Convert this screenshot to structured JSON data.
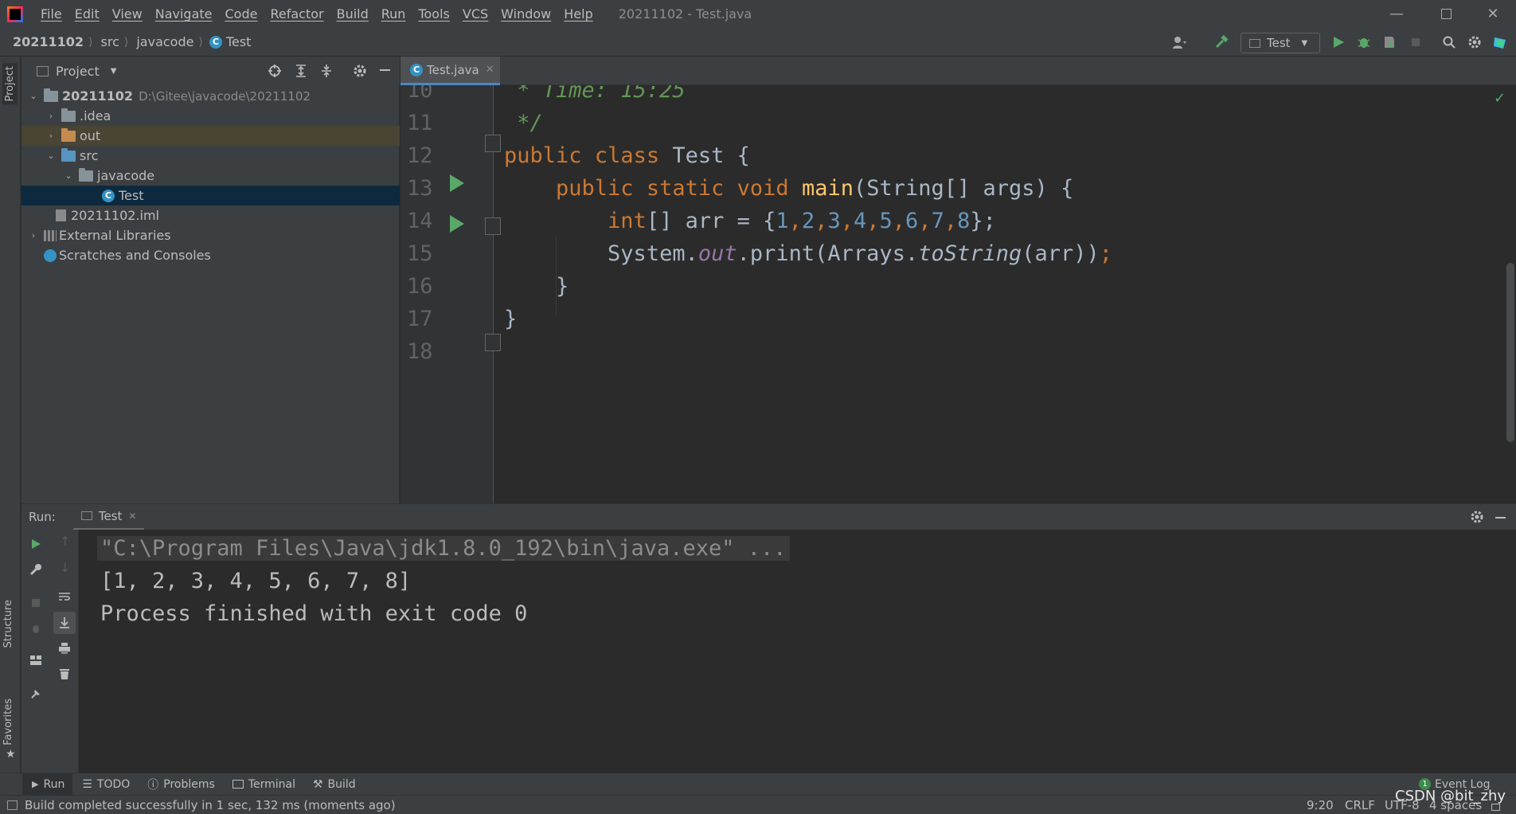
{
  "window": {
    "title": "20211102 - Test.java",
    "menu": [
      "File",
      "Edit",
      "View",
      "Navigate",
      "Code",
      "Refactor",
      "Build",
      "Run",
      "Tools",
      "VCS",
      "Window",
      "Help"
    ]
  },
  "breadcrumb": [
    "20211102",
    "src",
    "javacode",
    "Test"
  ],
  "toolbar": {
    "run_config": "Test"
  },
  "left_strip": {
    "project_tab": "Project",
    "structure_tab": "Structure",
    "favorites_tab": "Favorites"
  },
  "project": {
    "header": "Project",
    "tree": [
      {
        "label": "20211102",
        "path": "D:\\Gitee\\javacode\\20211102"
      },
      {
        "label": ".idea"
      },
      {
        "label": "out"
      },
      {
        "label": "src"
      },
      {
        "label": "javacode"
      },
      {
        "label": "Test"
      },
      {
        "label": "20211102.iml"
      },
      {
        "label": "External Libraries"
      },
      {
        "label": "Scratches and Consoles"
      }
    ]
  },
  "editor": {
    "tab": "Test.java",
    "line_numbers": [
      "10",
      "11",
      "12",
      "13",
      "14",
      "15",
      "16",
      "17",
      "18"
    ],
    "code": {
      "l10": " * Time: 15:25",
      "l11": " */",
      "l12_kw1": "public",
      "l12_kw2": "class",
      "l12_rest": "Test {",
      "l13_kw1": "public",
      "l13_kw2": "static",
      "l13_kw3": "void",
      "l13_fn": "main",
      "l13_rest": "(String[] args) {",
      "l14_kw": "int",
      "l14_a": "[] arr = {",
      "l14_nums": [
        "1",
        "2",
        "3",
        "4",
        "5",
        "6",
        "7",
        "8"
      ],
      "l14_end": "};",
      "l15_a": "System.",
      "l15_field": "out",
      "l15_b": ".print(Arrays.",
      "l15_it": "toString",
      "l15_c": "(arr))",
      "l15_semi": ";",
      "l16": "}",
      "l17": "}"
    }
  },
  "run": {
    "label": "Run:",
    "tab": "Test",
    "console": [
      "\"C:\\Program Files\\Java\\jdk1.8.0_192\\bin\\java.exe\" ...",
      "[1, 2, 3, 4, 5, 6, 7, 8]",
      "Process finished with exit code 0"
    ]
  },
  "tool_windows": [
    "Run",
    "TODO",
    "Problems",
    "Terminal",
    "Build"
  ],
  "event_log": {
    "count": "1",
    "label": "Event Log"
  },
  "status": {
    "message": "Build completed successfully in 1 sec, 132 ms (moments ago)",
    "position": "9:20",
    "line_sep": "CRLF",
    "encoding": "UTF-8",
    "indent": "4 spaces"
  },
  "watermark": "CSDN @bit_zhy",
  "colors": {
    "accent": "#4a88c7",
    "run_green": "#59a869",
    "keyword": "#cc7832",
    "comment": "#629755",
    "number": "#6897bb"
  }
}
